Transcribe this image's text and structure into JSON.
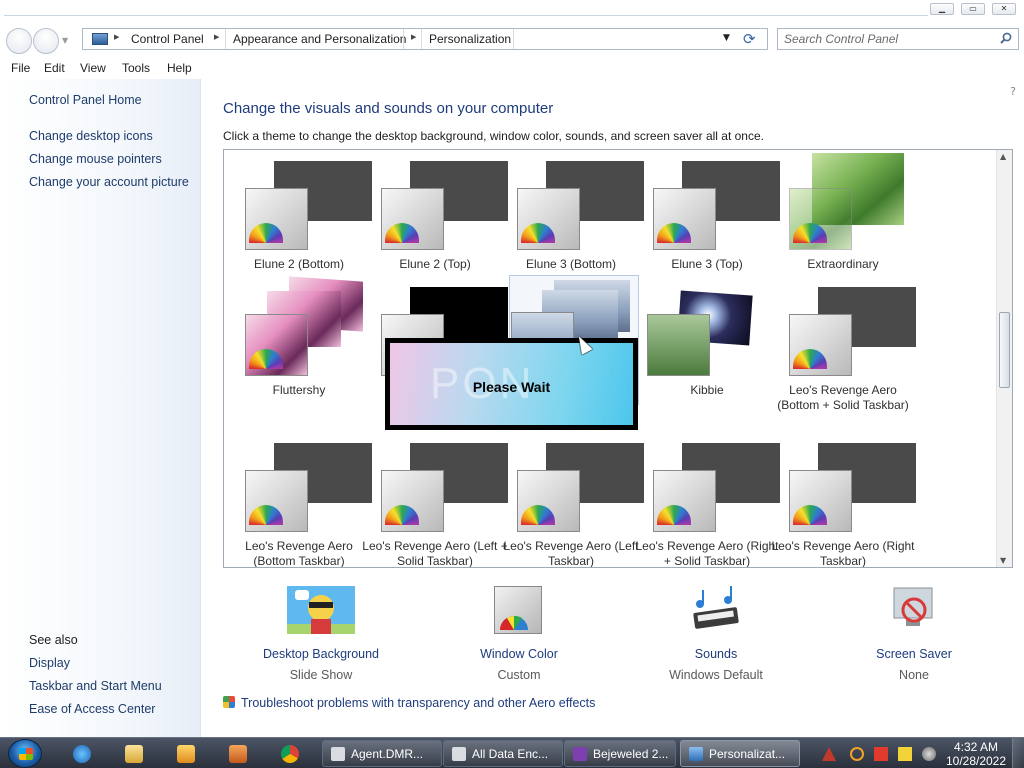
{
  "address": {
    "crumbs": [
      "Control Panel",
      "Appearance and Personalization",
      "Personalization"
    ],
    "search_placeholder": "Search Control Panel"
  },
  "menu": [
    "File",
    "Edit",
    "View",
    "Tools",
    "Help"
  ],
  "left_pane": {
    "home": "Control Panel Home",
    "links": [
      "Change desktop icons",
      "Change mouse pointers",
      "Change your account picture"
    ],
    "see_also_title": "See also",
    "see_also": [
      "Display",
      "Taskbar and Start Menu",
      "Ease of Access Center"
    ]
  },
  "main": {
    "title": "Change the visuals and sounds on your computer",
    "description": "Click a theme to change the desktop background, window color, sounds, and screen saver all at once."
  },
  "themes": [
    {
      "label": "Elune 2 (Bottom)"
    },
    {
      "label": "Elune 2 (Top)"
    },
    {
      "label": "Elune 3 (Bottom)"
    },
    {
      "label": "Elune 3 (Top)"
    },
    {
      "label": "Extraordinary"
    },
    {
      "label": "Fluttershy"
    },
    {
      "label": ""
    },
    {
      "label": ""
    },
    {
      "label": "Kibbie"
    },
    {
      "label": "Leo's Revenge Aero (Bottom + Solid Taskbar)"
    },
    {
      "label": "Leo's Revenge Aero (Bottom Taskbar)"
    },
    {
      "label": "Leo's Revenge Aero (Left + Solid Taskbar)"
    },
    {
      "label": "Leo's Revenge Aero (Left Taskbar)"
    },
    {
      "label": "Leo's Revenge Aero (Right + Solid Taskbar)"
    },
    {
      "label": "Leo's Revenge Aero (Right Taskbar)"
    }
  ],
  "please_wait": "Please Wait",
  "settings": [
    {
      "label": "Desktop Background",
      "value": "Slide Show"
    },
    {
      "label": "Window Color",
      "value": "Custom"
    },
    {
      "label": "Sounds",
      "value": "Windows Default"
    },
    {
      "label": "Screen Saver",
      "value": "None"
    }
  ],
  "troubleshoot": "Troubleshoot problems with transparency and other Aero effects",
  "taskbar": {
    "tasks": [
      {
        "label": "Agent.DMR..."
      },
      {
        "label": "All Data Enc..."
      },
      {
        "label": "Bejeweled 2..."
      },
      {
        "label": "Personalizat..."
      }
    ],
    "time": "4:32 AM",
    "date": "10/28/2022"
  }
}
